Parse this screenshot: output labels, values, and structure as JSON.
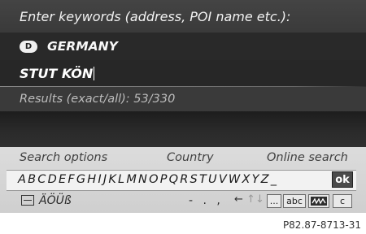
{
  "prompt": "Enter keywords (address, POI name etc.):",
  "country": {
    "badge": "D",
    "name": "GERMANY"
  },
  "entry": "STUT KÖN",
  "results": "Results (exact/all): 53/330",
  "options": {
    "search": "Search options",
    "country": "Country",
    "online": "Online search"
  },
  "keyboard": {
    "letters": "ABCDEFGHIJKLMNOPQRSTUVWXYZ_",
    "ok": "ok",
    "umlauts": "ÄÖÜß",
    "punct": "- . ,",
    "arrow_left": "←",
    "arrow_updown": "↑↓",
    "arrow_right": "→",
    "dots": "...",
    "abc": "abc",
    "c": "c"
  },
  "footer": "P82.87-8713-31"
}
